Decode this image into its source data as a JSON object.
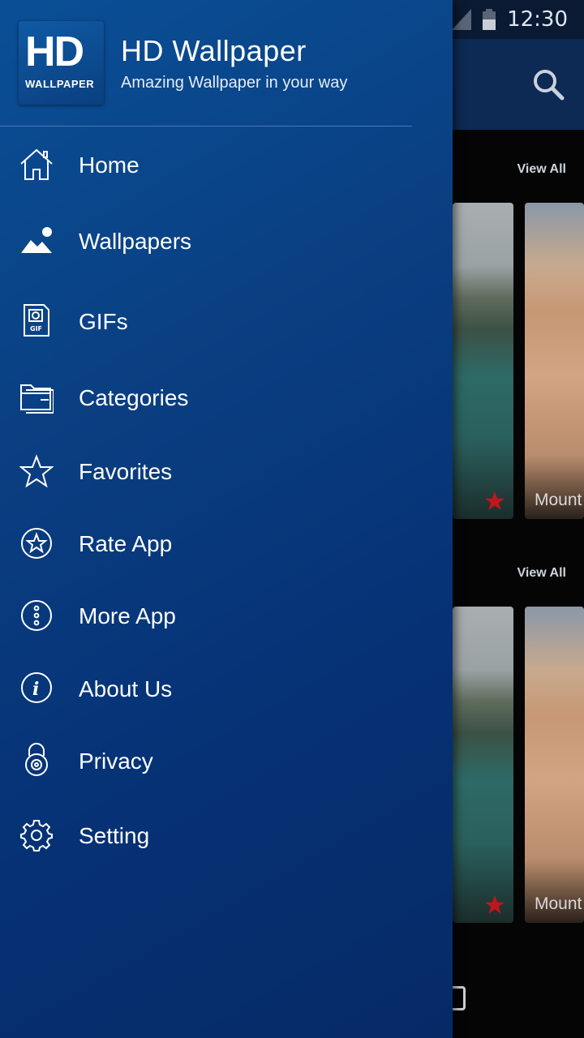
{
  "status_bar": {
    "time": "12:30"
  },
  "background": {
    "view_all_1": "View All",
    "view_all_2": "View All",
    "caption_1": "Mount",
    "caption_2": "Mount"
  },
  "drawer": {
    "logo": {
      "main": "HD",
      "sub": "WALLPAPER"
    },
    "title": "HD Wallpaper",
    "tagline": "Amazing Wallpaper in your way",
    "items": [
      {
        "label": "Home",
        "icon": "home-icon"
      },
      {
        "label": "Wallpapers",
        "icon": "image-icon"
      },
      {
        "label": "GIFs",
        "icon": "gif-file-icon"
      },
      {
        "label": "Categories",
        "icon": "folder-icon"
      },
      {
        "label": "Favorites",
        "icon": "star-icon"
      },
      {
        "label": "Rate App",
        "icon": "star-circle-icon"
      },
      {
        "label": "More App",
        "icon": "more-dots-icon"
      },
      {
        "label": "About Us",
        "icon": "info-icon"
      },
      {
        "label": "Privacy",
        "icon": "lock-icon"
      },
      {
        "label": "Setting",
        "icon": "gear-icon"
      }
    ]
  },
  "colors": {
    "drawer_top": "#0a4f96",
    "drawer_bottom": "#062a66",
    "favorite_star": "#c0161d"
  }
}
